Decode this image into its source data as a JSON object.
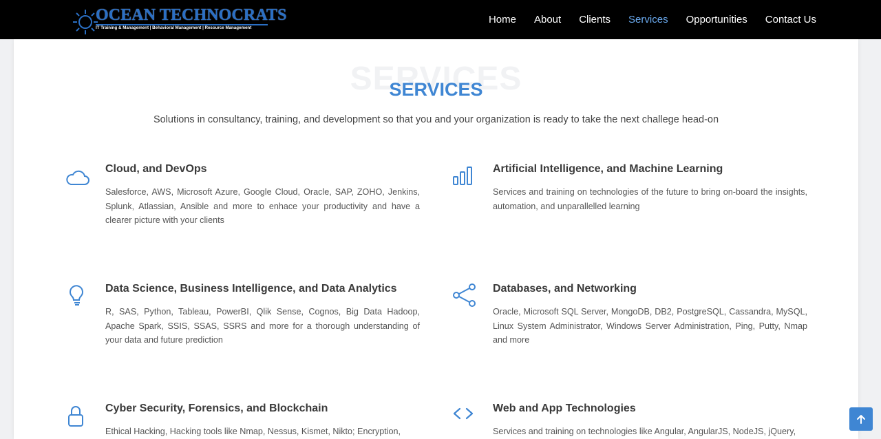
{
  "brand": {
    "name": "OCEAN TECHNOCRATS",
    "tagline": "IT Training & Management | Behavioral Management | Resource Management"
  },
  "nav": {
    "items": [
      {
        "label": "Home"
      },
      {
        "label": "About"
      },
      {
        "label": "Clients"
      },
      {
        "label": "Services",
        "active": true
      },
      {
        "label": "Opportunities"
      },
      {
        "label": "Contact Us"
      }
    ]
  },
  "section": {
    "background_title": "SERVICES",
    "title": "SERVICES",
    "subtitle": "Solutions in consultancy, training, and development so that you and your organization is ready to take the next challege head-on"
  },
  "services": [
    {
      "icon": "cloud-icon",
      "title": "Cloud, and DevOps",
      "description": "Salesforce, AWS, Microsoft Azure, Google Cloud, Oracle, SAP, ZOHO, Jenkins, Splunk, Atlassian, Ansible and more to enhace your productivity and have a clearer picture with your clients"
    },
    {
      "icon": "bar-chart-icon",
      "title": "Artificial Intelligence, and Machine Learning",
      "description": "Services and training on technologies of the future to bring on-board the insights, automation, and unparallelled learning"
    },
    {
      "icon": "lightbulb-icon",
      "title": "Data Science, Business Intelligence, and Data Analytics",
      "description": "R, SAS, Python, Tableau, PowerBI, Qlik Sense, Cognos, Big Data Hadoop, Apache Spark, SSIS, SSAS, SSRS and more for a thorough understanding of your data and future prediction"
    },
    {
      "icon": "share-icon",
      "title": "Databases, and Networking",
      "description": "Oracle, Microsoft SQL Server, MongoDB, DB2, PostgreSQL, Cassandra, MySQL, Linux System Administrator, Windows Server Administration, Ping, Putty, Nmap and more"
    },
    {
      "icon": "lock-icon",
      "title": "Cyber Security, Forensics, and Blockchain",
      "description": "Ethical Hacking, Hacking tools like Nmap, Nessus, Kismet, Nikto; Encryption,"
    },
    {
      "icon": "code-icon",
      "title": "Web and App Technologies",
      "description": "Services and training on technologies like Angular, AngularJS, NodeJS, jQuery,"
    }
  ],
  "colors": {
    "accent": "#3f86d3",
    "nav_active": "#6aa9ee",
    "navbar_bg": "#000000"
  }
}
